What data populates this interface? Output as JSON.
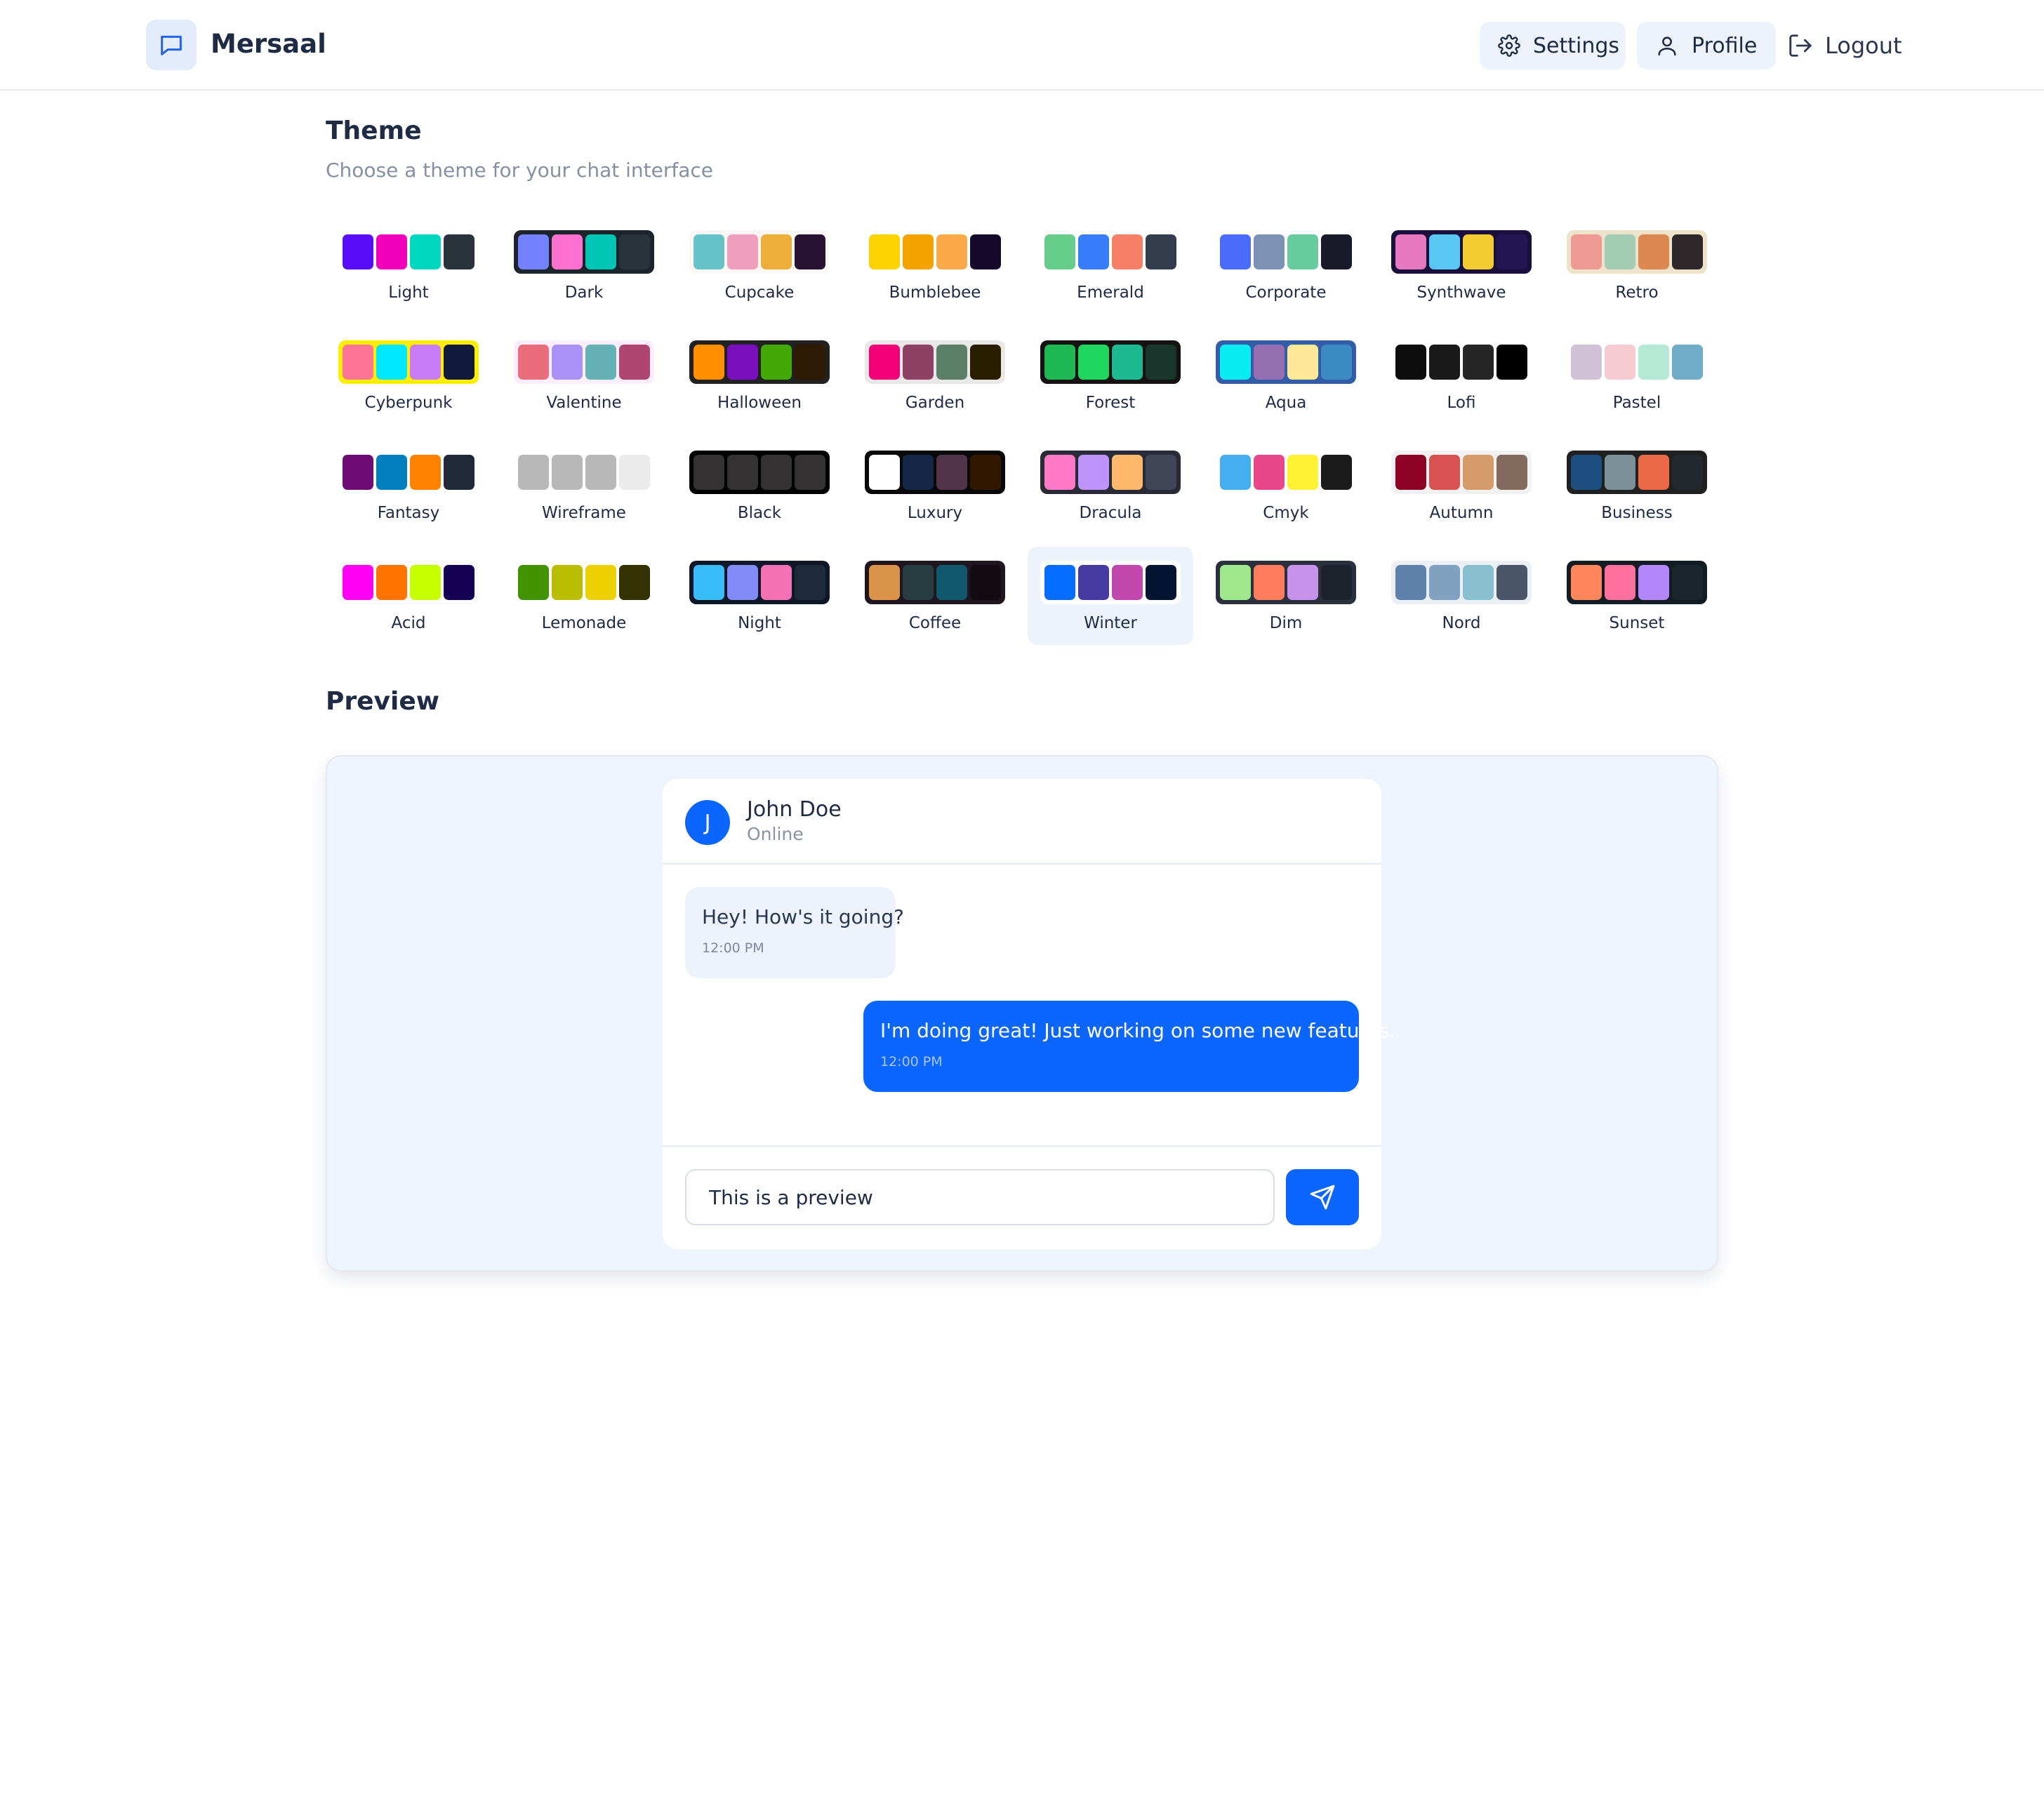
{
  "app": {
    "name": "Mersaal"
  },
  "nav": {
    "settings": "Settings",
    "profile": "Profile",
    "logout": "Logout"
  },
  "theme_section": {
    "title": "Theme",
    "subtitle": "Choose a theme for your chat interface",
    "selected": "Winter",
    "themes": [
      {
        "name": "Light",
        "bg": "#ffffff",
        "colors": [
          "#570df8",
          "#f000b8",
          "#00d7c0",
          "#2a323c"
        ]
      },
      {
        "name": "Dark",
        "bg": "#1d232a",
        "colors": [
          "#7582ff",
          "#ff71cf",
          "#00c7b5",
          "#2a323c"
        ]
      },
      {
        "name": "Cupcake",
        "bg": "#faf7f5",
        "colors": [
          "#65c3c8",
          "#ef9fbc",
          "#eeaf3a",
          "#291334"
        ]
      },
      {
        "name": "Bumblebee",
        "bg": "#ffffff",
        "colors": [
          "#fbd400",
          "#f5a300",
          "#fba949",
          "#150a2c"
        ]
      },
      {
        "name": "Emerald",
        "bg": "#ffffff",
        "colors": [
          "#66cc8a",
          "#377cfb",
          "#f68067",
          "#333c4d"
        ]
      },
      {
        "name": "Corporate",
        "bg": "#ffffff",
        "colors": [
          "#4b6bfb",
          "#7b92b2",
          "#67cba0",
          "#181a2a"
        ]
      },
      {
        "name": "Synthwave",
        "bg": "#1a103d",
        "colors": [
          "#e779c1",
          "#58c7f3",
          "#f3cc30",
          "#221551"
        ]
      },
      {
        "name": "Retro",
        "bg": "#ece3ca",
        "colors": [
          "#ef9995",
          "#a4cbb4",
          "#dc8850",
          "#2e282a"
        ]
      },
      {
        "name": "Cyberpunk",
        "bg": "#ffee00",
        "colors": [
          "#ff7598",
          "#00e8ff",
          "#c97cf5",
          "#111a3b"
        ]
      },
      {
        "name": "Valentine",
        "bg": "#f9eefa",
        "colors": [
          "#e96d7b",
          "#a991f7",
          "#66b1b3",
          "#af4670"
        ]
      },
      {
        "name": "Halloween",
        "bg": "#212121",
        "colors": [
          "#ff8f00",
          "#7a0fbf",
          "#42a909",
          "#2f1b05"
        ]
      },
      {
        "name": "Garden",
        "bg": "#e9e7e7",
        "colors": [
          "#f40076",
          "#8e4162",
          "#5c7f67",
          "#291e00"
        ]
      },
      {
        "name": "Forest",
        "bg": "#171212",
        "colors": [
          "#1eb854",
          "#1fd65f",
          "#1db990",
          "#19362d"
        ]
      },
      {
        "name": "Aqua",
        "bg": "#345da7",
        "colors": [
          "#09ecf3",
          "#966fb3",
          "#ffe999",
          "#3b8ac4"
        ]
      },
      {
        "name": "Lofi",
        "bg": "#ffffff",
        "colors": [
          "#0d0d0d",
          "#1a1919",
          "#262626",
          "#000000"
        ]
      },
      {
        "name": "Pastel",
        "bg": "#ffffff",
        "colors": [
          "#d1c1d7",
          "#f6cbd1",
          "#b4e9d6",
          "#70acc7"
        ]
      },
      {
        "name": "Fantasy",
        "bg": "#ffffff",
        "colors": [
          "#6e0b75",
          "#007ebd",
          "#ff8300",
          "#1f2937"
        ]
      },
      {
        "name": "Wireframe",
        "bg": "#ffffff",
        "colors": [
          "#b8b8b8",
          "#b8b8b8",
          "#b8b8b8",
          "#ebebeb"
        ]
      },
      {
        "name": "Black",
        "bg": "#000000",
        "colors": [
          "#343232",
          "#343232",
          "#343232",
          "#343232"
        ]
      },
      {
        "name": "Luxury",
        "bg": "#09090b",
        "colors": [
          "#ffffff",
          "#152747",
          "#513448",
          "#331800"
        ]
      },
      {
        "name": "Dracula",
        "bg": "#282a36",
        "colors": [
          "#ff79c6",
          "#bd93f9",
          "#ffb86c",
          "#414558"
        ]
      },
      {
        "name": "Cmyk",
        "bg": "#ffffff",
        "colors": [
          "#45aeee",
          "#e8488a",
          "#fff232",
          "#1a1a1a"
        ]
      },
      {
        "name": "Autumn",
        "bg": "#f1f1f1",
        "colors": [
          "#8c0327",
          "#d85251",
          "#d59b6a",
          "#826a5c"
        ]
      },
      {
        "name": "Business",
        "bg": "#202020",
        "colors": [
          "#1c4e80",
          "#7c909a",
          "#ea6947",
          "#23282e"
        ]
      },
      {
        "name": "Acid",
        "bg": "#fafafa",
        "colors": [
          "#ff00f4",
          "#ff7400",
          "#c8ff00",
          "#140151"
        ]
      },
      {
        "name": "Lemonade",
        "bg": "#ffffff",
        "colors": [
          "#419400",
          "#bbbd00",
          "#edd000",
          "#343300"
        ]
      },
      {
        "name": "Night",
        "bg": "#0f1729",
        "colors": [
          "#38bdf8",
          "#818cf8",
          "#f471b5",
          "#1e293b"
        ]
      },
      {
        "name": "Coffee",
        "bg": "#20161f",
        "colors": [
          "#db924b",
          "#263e3f",
          "#10576d",
          "#120c12"
        ]
      },
      {
        "name": "Winter",
        "bg": "#ffffff",
        "colors": [
          "#056dff",
          "#463aa1",
          "#c148ac",
          "#021431"
        ]
      },
      {
        "name": "Dim",
        "bg": "#2a303c",
        "colors": [
          "#9fe88d",
          "#ff7d5c",
          "#c792e9",
          "#1c212b"
        ]
      },
      {
        "name": "Nord",
        "bg": "#eceff4",
        "colors": [
          "#5e81ac",
          "#81a1c1",
          "#88c0d0",
          "#4c566a"
        ]
      },
      {
        "name": "Sunset",
        "bg": "#121c22",
        "colors": [
          "#ff865b",
          "#fd6f9c",
          "#b387fa",
          "#1b262c"
        ]
      }
    ]
  },
  "preview": {
    "title": "Preview",
    "contact": {
      "initial": "J",
      "name": "John Doe",
      "status": "Online"
    },
    "messages": [
      {
        "text": "Hey! How's it going?",
        "time": "12:00 PM",
        "direction": "in"
      },
      {
        "text": "I'm doing great! Just working on some new features.",
        "time": "12:00 PM",
        "direction": "out"
      }
    ],
    "input_value": "This is a preview"
  },
  "colors": {
    "accent": "#0a66ff",
    "text": "#1f2a44",
    "muted": "#8690a3",
    "surface": "#eef3fb"
  }
}
